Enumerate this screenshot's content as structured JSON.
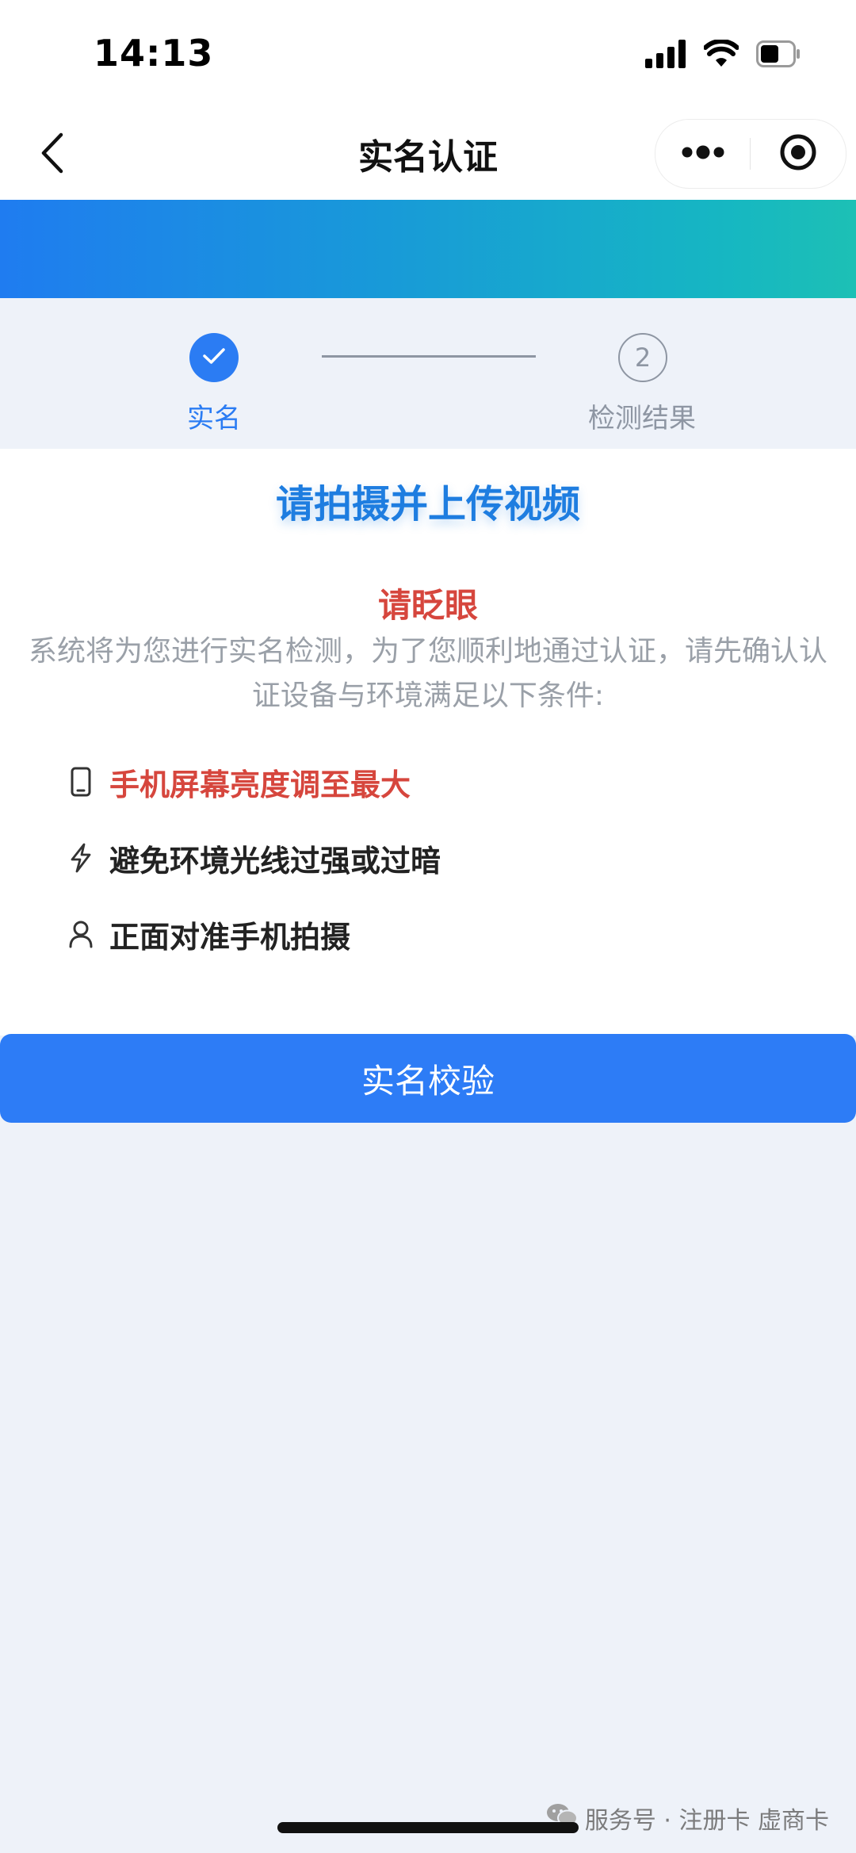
{
  "status_bar": {
    "time": "14:13",
    "icons": [
      "signal-icon",
      "wifi-icon",
      "battery-icon"
    ]
  },
  "nav": {
    "back_icon": "chevron-left-icon",
    "title": "实名认证",
    "more_icon": "more-dots-icon",
    "close_icon": "target-close-icon"
  },
  "steps": [
    {
      "label": "实名",
      "state": "done",
      "icon": "check-icon"
    },
    {
      "label": "检测结果",
      "state": "todo",
      "number": "2"
    }
  ],
  "content": {
    "heading": "请拍摄并上传视频",
    "action": "请眨眼",
    "description": "系统将为您进行实名检测，为了您顺利地通过认证，请先确认认证设备与环境满足以下条件:",
    "requirements": [
      {
        "text": "手机屏幕亮度调至最大",
        "icon": "phone-icon",
        "highlight": true
      },
      {
        "text": "避免环境光线过强或过暗",
        "icon": "lightning-icon",
        "highlight": false
      },
      {
        "text": "正面对准手机拍摄",
        "icon": "person-icon",
        "highlight": false
      }
    ]
  },
  "submit_label": "实名校验",
  "watermark": {
    "icon": "wechat-icon",
    "text": "服务号 · 注册卡 虚商卡"
  },
  "colors": {
    "accent": "#2b7cf3",
    "button": "#2d7cf6",
    "warning": "#d6463d",
    "muted": "#8e96a3",
    "page_bg": "#eef2f9"
  }
}
